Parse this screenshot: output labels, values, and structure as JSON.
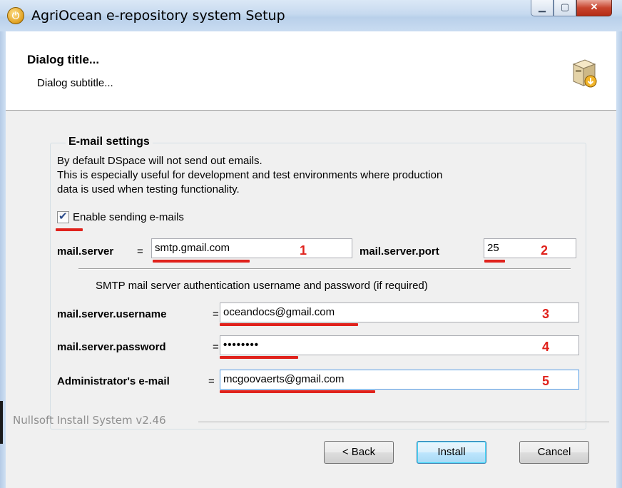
{
  "window": {
    "title": "AgriOcean e-repository system Setup",
    "controls": [
      "minimize",
      "maximize",
      "close"
    ]
  },
  "header": {
    "title": "Dialog title...",
    "subtitle": "Dialog subtitle...",
    "icon": "installer-box-icon"
  },
  "group": {
    "legend": "E-mail settings",
    "description": [
      "By default DSpace will not send out emails.",
      "This is especially useful for development and test environments where production",
      "data is used when testing functionality."
    ],
    "enable_checkbox": {
      "label": "Enable sending e-mails",
      "checked": true
    },
    "server": {
      "label": "mail.server",
      "eq": "=",
      "value": "smtp.gmail.com",
      "marker": "1"
    },
    "port": {
      "label": "mail.server.port",
      "value": "25",
      "marker": "2"
    },
    "smtp_note": "SMTP mail server authentication username and password (if required)",
    "username": {
      "label": "mail.server.username",
      "eq": "=",
      "value": "oceandocs@gmail.com",
      "marker": "3"
    },
    "password": {
      "label": "mail.server.password",
      "eq": "=",
      "value": "••••••••",
      "marker": "4"
    },
    "admin_email": {
      "label": "Administrator's e-mail",
      "eq": "=",
      "value": "mcgoovaerts@gmail.com",
      "marker": "5"
    }
  },
  "footer": {
    "branding": "Nullsoft Install System v2.46",
    "back_label": "< Back",
    "install_label": "Install",
    "cancel_label": "Cancel"
  },
  "colors": {
    "annotation": "#e0221c",
    "focus_border": "#569de5"
  }
}
